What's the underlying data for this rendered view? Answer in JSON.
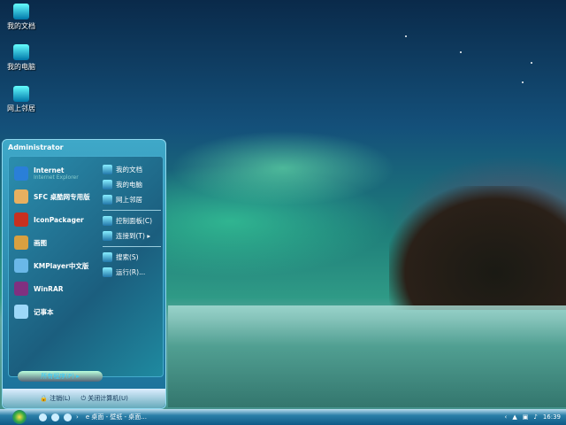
{
  "desktop": {
    "icons": [
      {
        "label": "我的文档",
        "icon": "my-documents-icon"
      },
      {
        "label": "我的电脑",
        "icon": "my-computer-icon"
      },
      {
        "label": "网上邻居",
        "icon": "network-places-icon"
      }
    ]
  },
  "start_menu": {
    "user": "Administrator",
    "left_items": [
      {
        "label": "Internet",
        "sub": "Internet Explorer",
        "color": "#2a7fd8"
      },
      {
        "label": "SFC 桌酷网专用版",
        "color": "#e8b060"
      },
      {
        "label": "IconPackager",
        "color": "#c83020"
      },
      {
        "label": "画图",
        "color": "#d8a040"
      },
      {
        "label": "KMPlayer中文版",
        "color": "#6ab8e8"
      },
      {
        "label": "WinRAR",
        "color": "#803080"
      },
      {
        "label": "记事本",
        "color": "#9cd8f8"
      }
    ],
    "right_items": [
      {
        "label": "我的文档"
      },
      {
        "label": "我的电脑"
      },
      {
        "label": "网上邻居"
      },
      {
        "label": "控制面板(C)"
      },
      {
        "label": "连接到(T) ▸"
      },
      {
        "label": "搜索(S)"
      },
      {
        "label": "运行(R)..."
      }
    ],
    "all_programs": "所有程序(P) ▸",
    "logoff": "注销(L)",
    "shutdown": "关闭计算机(U)"
  },
  "taskbar": {
    "task": "桌面 - 壁纸 - 桌面...",
    "clock": "16:39"
  }
}
